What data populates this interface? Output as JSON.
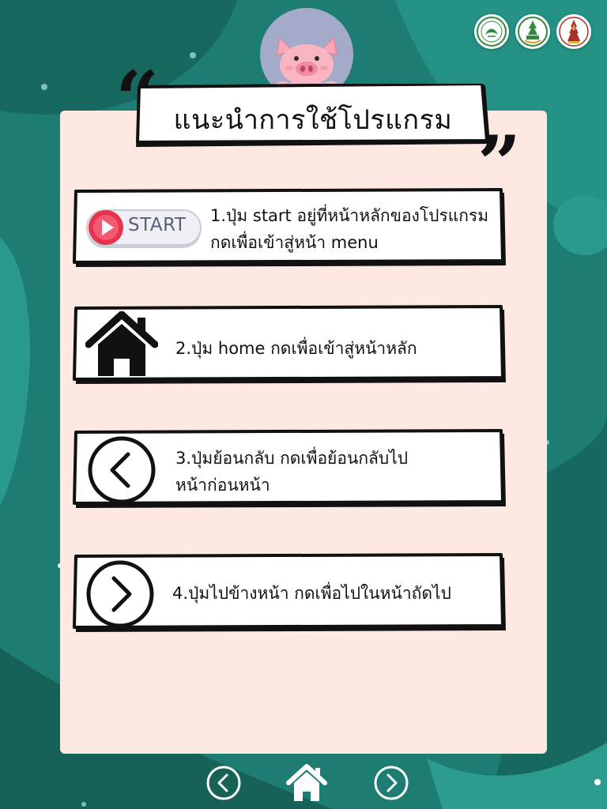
{
  "title": "แนะนำการใช้โปรแกรม",
  "instructions": [
    {
      "icon": "start-button-icon",
      "button_label": "START",
      "lines": [
        "1.ปุ่ม start อยู่ที่หน้าหลักของโปรแกรม",
        "กดเพื่อเข้าสู่หน้า menu"
      ]
    },
    {
      "icon": "home-icon",
      "lines": [
        "2.ปุ่ม home กดเพื่อเข้าสู่หน้าหลัก"
      ]
    },
    {
      "icon": "back-arrow-icon",
      "lines": [
        "3.ปุ่มย้อนกลับ กดเพื่อย้อนกลับไป",
        "หน้าก่อนหน้า"
      ]
    },
    {
      "icon": "forward-arrow-icon",
      "lines": [
        "4.ปุ่มไปข้างหน้า กดเพื่อไปในหน้าถัดไป"
      ]
    }
  ],
  "nav": {
    "back_icon": "back-circle-icon",
    "home_icon": "home-icon",
    "next_icon": "next-circle-icon"
  },
  "colors": {
    "background": "#1f7f74",
    "panel": "#fde8e2",
    "pig_badge": "#a3abc9",
    "pig": "#f7a8b8",
    "start_red": "#e8334f"
  }
}
